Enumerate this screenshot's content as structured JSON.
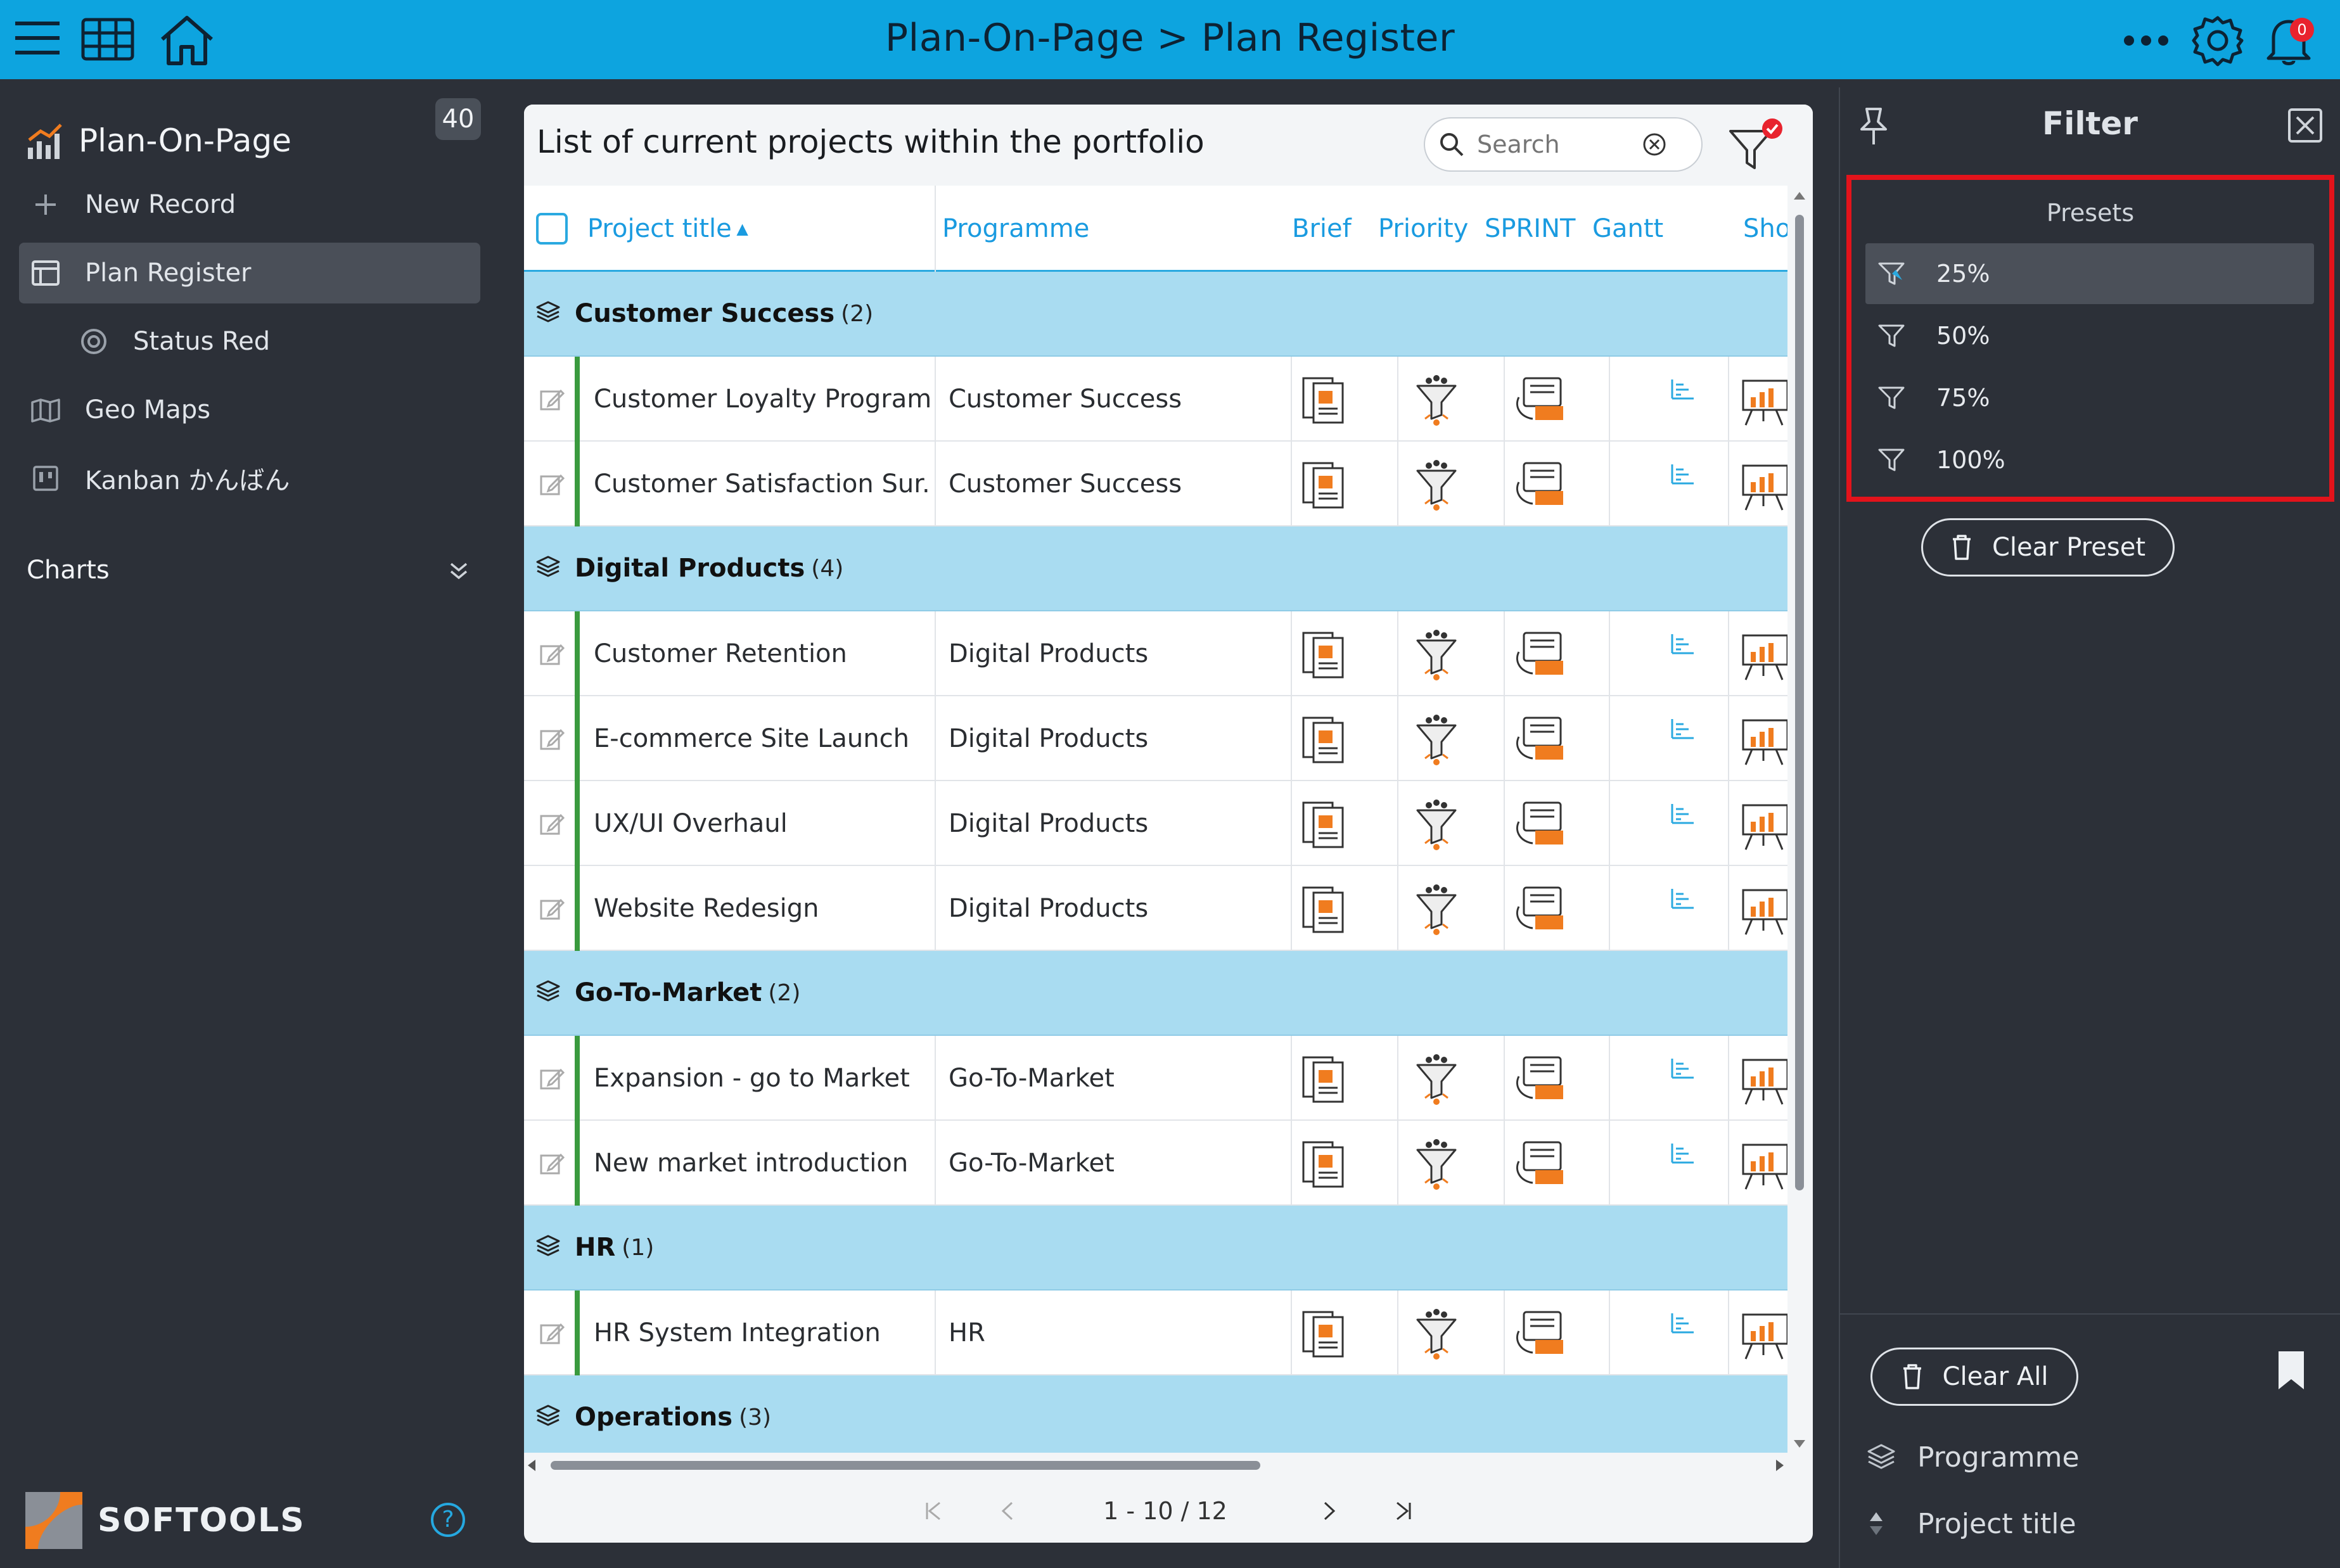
{
  "topbar": {
    "title": "Plan-On-Page > Plan Register",
    "notification_count": "0",
    "icons": [
      "hamburger-icon",
      "grid-icon",
      "home-icon",
      "more-icon",
      "gear-icon",
      "bell-icon"
    ]
  },
  "sidebar": {
    "app_title": "Plan-On-Page",
    "count": "40",
    "items": [
      {
        "label": "New Record",
        "icon": "plus-icon"
      },
      {
        "label": "Plan Register",
        "icon": "table-icon"
      },
      {
        "label": "Status Red",
        "icon": "target-icon"
      },
      {
        "label": "Geo Maps",
        "icon": "map-icon"
      },
      {
        "label": "Kanban かんばん",
        "icon": "kanban-icon"
      }
    ],
    "section_charts": "Charts",
    "brand": "SOFTOOLS",
    "help": "?"
  },
  "main": {
    "list_title": "List of current projects within the portfolio",
    "search_placeholder": "Search",
    "columns": [
      "Project title",
      "Programme",
      "Brief",
      "Priority",
      "SPRINT",
      "Gantt",
      "Sho"
    ],
    "groups": [
      {
        "name": "Customer Success",
        "count": "(2)"
      },
      {
        "name": "Digital Products",
        "count": "(4)"
      },
      {
        "name": "Go-To-Market",
        "count": "(2)"
      },
      {
        "name": "HR",
        "count": "(1)"
      },
      {
        "name": "Operations",
        "count": "(3)"
      }
    ],
    "rows": [
      {
        "title": "Customer Loyalty Program",
        "programme": "Customer Success"
      },
      {
        "title": "Customer Satisfaction Sur...",
        "programme": "Customer Success"
      },
      {
        "title": "Customer Retention",
        "programme": "Digital Products"
      },
      {
        "title": "E-commerce Site Launch",
        "programme": "Digital Products"
      },
      {
        "title": "UX/UI Overhaul",
        "programme": "Digital Products"
      },
      {
        "title": "Website Redesign",
        "programme": "Digital Products"
      },
      {
        "title": "Expansion - go to Market",
        "programme": "Go-To-Market"
      },
      {
        "title": "New market introduction",
        "programme": "Go-To-Market"
      },
      {
        "title": "HR System Integration",
        "programme": "HR"
      }
    ],
    "pager": "1 - 10 / 12"
  },
  "filter": {
    "title": "Filter",
    "presets_label": "Presets",
    "presets": [
      "25%",
      "50%",
      "75%",
      "100%"
    ],
    "active_preset": "25%",
    "clear_preset": "Clear Preset",
    "clear_all": "Clear All",
    "fields": [
      "Programme",
      "Project title"
    ]
  },
  "colors": {
    "accent": "#0da4df",
    "group_bg": "#a9dcf1",
    "sidebar_bg": "#2c3038",
    "highlight": "#e3131b",
    "status_green": "#3a9a3e"
  }
}
